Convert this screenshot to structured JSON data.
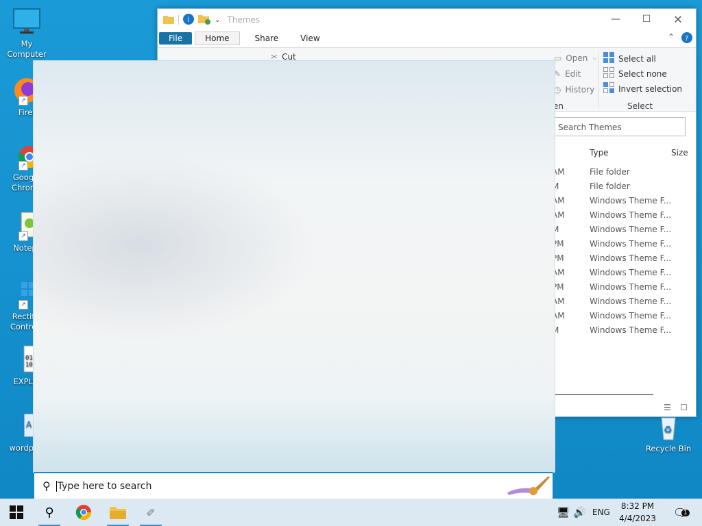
{
  "desktop": {
    "icons": [
      {
        "label": "My Computer"
      },
      {
        "label": "Firef"
      },
      {
        "label": "Goog Chron"
      },
      {
        "label": "Notepa"
      },
      {
        "label": "Rectif Contro"
      },
      {
        "label": "EXPLO"
      },
      {
        "label": "wordpac"
      }
    ],
    "recycle_bin": "Recycle Bin"
  },
  "explorer": {
    "title": "Themes",
    "tabs": [
      "File",
      "Home",
      "Share",
      "View"
    ],
    "ribbon": {
      "cut": "Cut",
      "open": "Open",
      "edit": "Edit",
      "history": "History",
      "open_group_partial": "en",
      "select_all": "Select all",
      "select_none": "Select none",
      "invert_selection": "Invert selection",
      "select_group": "Select"
    },
    "search_placeholder": "Search Themes",
    "columns": {
      "type": "Type",
      "size": "Size"
    },
    "rows": [
      {
        "date": "AM",
        "type": "File folder"
      },
      {
        "date": "M",
        "type": "File folder"
      },
      {
        "date": "AM",
        "type": "Windows Theme F..."
      },
      {
        "date": "AM",
        "type": "Windows Theme F..."
      },
      {
        "date": "M",
        "type": "Windows Theme F..."
      },
      {
        "date": "PM",
        "type": "Windows Theme F..."
      },
      {
        "date": "PM",
        "type": "Windows Theme F..."
      },
      {
        "date": "AM",
        "type": "Windows Theme F..."
      },
      {
        "date": "PM",
        "type": "Windows Theme F..."
      },
      {
        "date": "AM",
        "type": "Windows Theme F..."
      },
      {
        "date": "AM",
        "type": "Windows Theme F..."
      },
      {
        "date": "M",
        "type": "Windows Theme F..."
      }
    ]
  },
  "search": {
    "placeholder": "Type here to search"
  },
  "taskbar": {
    "lang": "ENG",
    "time": "8:32 PM",
    "date": "4/4/2023",
    "notification_count": "1"
  }
}
